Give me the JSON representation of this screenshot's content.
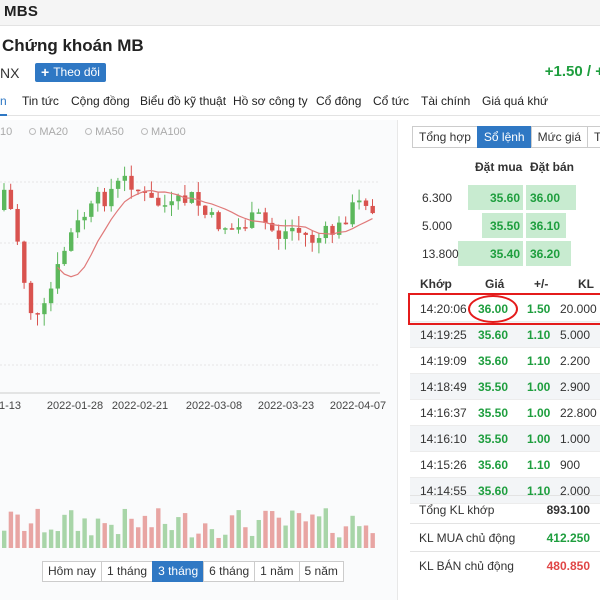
{
  "app": {
    "brand": "MBS"
  },
  "stock": {
    "company_name": "Chứng khoán MB",
    "exchange_prefix": "NX",
    "follow_label": "Theo dõi",
    "change_text": "+1.50 / +"
  },
  "tabs": [
    "n",
    "Tin tức",
    "Cộng đồng",
    "Biểu đồ kỹ thuật",
    "Hồ sơ công ty",
    "Cổ đông",
    "Cổ tức",
    "Tài chính",
    "Giá quá khứ"
  ],
  "chart": {
    "legend": [
      "10",
      "MA20",
      "MA50",
      "MA100"
    ],
    "x_dates": [
      "1-13",
      "2022-01-28",
      "2022-02-21",
      "2022-03-08",
      "2022-03-23",
      "2022-04-07"
    ],
    "ranges": [
      "Hôm nay",
      "1 tháng",
      "3 tháng",
      "6 tháng",
      "1 năm",
      "5 năm"
    ],
    "active_range": "3 tháng",
    "up_color": "#5cb85c",
    "down_color": "#d9534f",
    "ma_color": "#e07a7a"
  },
  "chart_data": {
    "type": "candlestick",
    "x_tick_labels": [
      "1-13",
      "2022-01-28",
      "2022-02-21",
      "2022-03-08",
      "2022-03-23",
      "2022-04-07"
    ],
    "legend": [
      "MA20",
      "MA50",
      "MA100"
    ],
    "series_note": "price candles with moving average, volume bars below"
  },
  "right_panel": {
    "sub_tabs": [
      "Tổng hợp",
      "Sổ lệnh",
      "Mức giá",
      "Thố"
    ],
    "active_sub_tab": "Sổ lệnh",
    "orderbook_headers": {
      "buy": "Đặt mua",
      "sell": "Đặt bán"
    },
    "orderbook": [
      {
        "vol": "6.300",
        "buy": "35.60",
        "sell": "36.00"
      },
      {
        "vol": "5.000",
        "buy": "35.50",
        "sell": "36.10"
      },
      {
        "vol": "13.800",
        "buy": "35.40",
        "sell": "36.20"
      }
    ],
    "trade_headers": {
      "time": "Khớp",
      "price": "Giá",
      "change": "+/-",
      "volume": "KL"
    },
    "trades": [
      {
        "time": "14:20:06",
        "price": "36.00",
        "change": "1.50",
        "volume": "20.000"
      },
      {
        "time": "14:19:25",
        "price": "35.60",
        "change": "1.10",
        "volume": "5.000"
      },
      {
        "time": "14:19:09",
        "price": "35.60",
        "change": "1.10",
        "volume": "2.200"
      },
      {
        "time": "14:18:49",
        "price": "35.50",
        "change": "1.00",
        "volume": "2.900"
      },
      {
        "time": "14:16:37",
        "price": "35.50",
        "change": "1.00",
        "volume": "22.800"
      },
      {
        "time": "14:16:10",
        "price": "35.50",
        "change": "1.00",
        "volume": "1.000"
      },
      {
        "time": "14:15:26",
        "price": "35.60",
        "change": "1.10",
        "volume": "900"
      },
      {
        "time": "14:14:55",
        "price": "35.60",
        "change": "1.10",
        "volume": "2.000"
      }
    ],
    "summary": [
      {
        "label": "Tổng KL khớp",
        "value": "893.100",
        "color": "#333333"
      },
      {
        "label": "KL MUA chủ động",
        "value": "412.250",
        "color": "#1e9e3e"
      },
      {
        "label": "KL BÁN chủ động",
        "value": "480.850",
        "color": "#e04646"
      }
    ]
  }
}
